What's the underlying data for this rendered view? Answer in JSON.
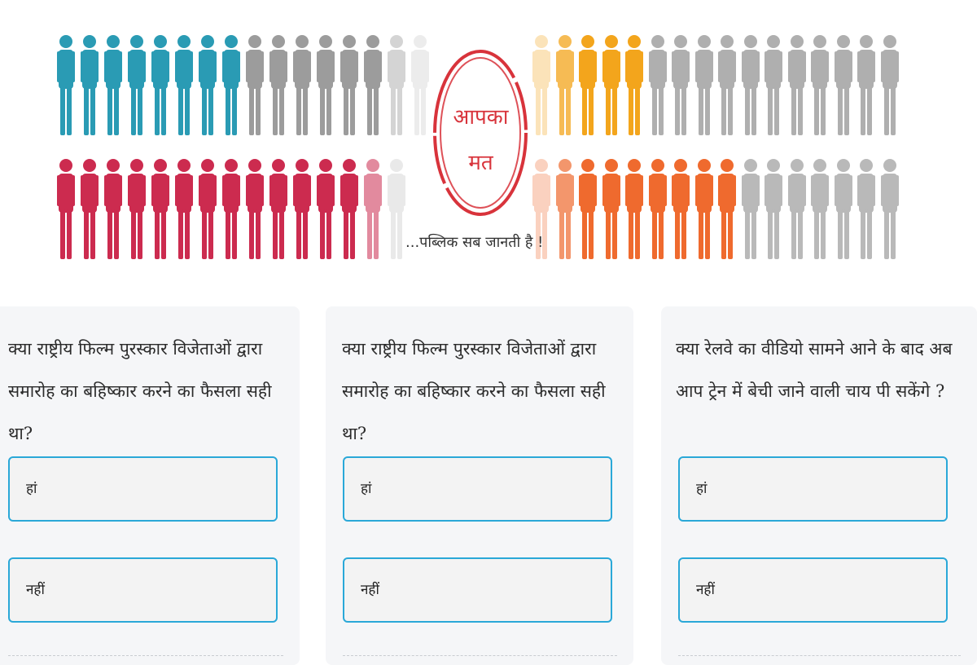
{
  "banner": {
    "seal_line1": "आपका",
    "seal_line2": "मत",
    "tagline": "...पब्लिक सब जानती है !",
    "colors": {
      "teal": "#2a9bb4",
      "crimson": "#cc2b4f",
      "amber": "#f3a51c",
      "orange": "#ef6a2e",
      "gray": "#9c9c9c",
      "light_gray": "#c3c3c3",
      "seal_red": "#d8333b"
    }
  },
  "polls": [
    {
      "question": "क्या राष्ट्रीय फिल्म पुरस्कार विजेताओं द्वारा समारोह का बहिष्कार करने का फैसला सही था?",
      "options": [
        "हां",
        "नहीं"
      ]
    },
    {
      "question": "क्या राष्ट्रीय फिल्म पुरस्कार विजेताओं द्वारा समारोह का बहिष्कार करने का फैसला सही था?",
      "options": [
        "हां",
        "नहीं"
      ]
    },
    {
      "question": "क्या रेलवे का वीडियो सामने आने के बाद अब आप ट्रेन में बेची जाने वाली चाय पी सकेंगे ?",
      "options": [
        "हां",
        "नहीं"
      ]
    }
  ]
}
